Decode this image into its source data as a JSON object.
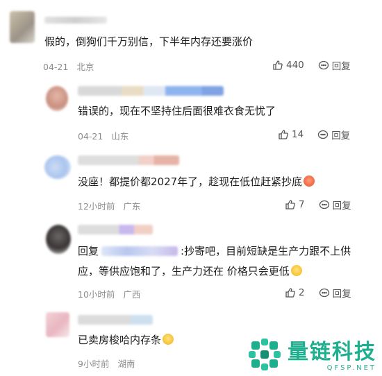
{
  "comments": [
    {
      "text": "假的，倒狗们千万别信，下半年内存还要涨价",
      "date": "04-21",
      "location": "北京",
      "likes": "440",
      "reply_label": "回复"
    },
    {
      "text": "错误的，现在不坚持住后面很难衣食无忧了",
      "date": "04-21",
      "location": "山东",
      "likes": "14",
      "reply_label": "回复"
    },
    {
      "text": "没座！都提价都2027年了，趁现在低位赶紧抄底",
      "date": "12小时前",
      "location": "广东",
      "likes": "7",
      "reply_label": "回复"
    },
    {
      "reply_prefix": "回复",
      "text_line1": ":抄寄吧，目前短缺是生产力跟不上供",
      "text_line2": "应，等供应饱和了，生产力还在 价格只会更低",
      "date": "10小时前",
      "location": "广西",
      "likes": "2",
      "reply_label": "回复"
    },
    {
      "text": "已卖房梭哈内存条",
      "date": "9小时前",
      "location": "湖南"
    }
  ],
  "watermark": {
    "title": "量链科技",
    "url": "QFSP.NET"
  },
  "icons": {
    "like": "thumbs-up-icon",
    "reply": "speech-bubble-icon",
    "emoji": "grinning-face-emoji"
  },
  "colors": {
    "accent": "#1fae8e",
    "meta": "#8c8c8c"
  }
}
